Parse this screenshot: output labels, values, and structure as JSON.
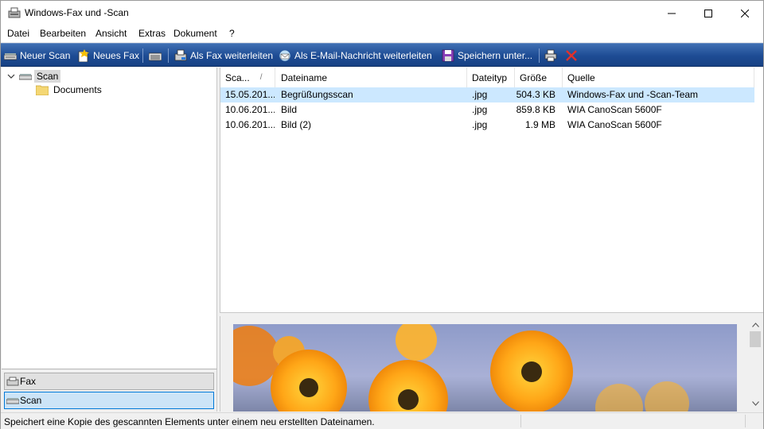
{
  "window": {
    "title": "Windows-Fax und -Scan"
  },
  "menu": [
    {
      "label": "Datei"
    },
    {
      "label": "Bearbeiten"
    },
    {
      "label": "Ansicht"
    },
    {
      "label": "Extras"
    },
    {
      "label": "Dokument"
    },
    {
      "label": "?"
    }
  ],
  "toolbar": {
    "new_scan": "Neuer Scan",
    "new_fax": "Neues Fax",
    "forward_fax": "Als Fax weiterleiten",
    "forward_email": "Als E-Mail-Nachricht weiterleiten",
    "save_as": "Speichern unter...",
    "accent": "#1e4c94"
  },
  "tree": {
    "root": "Scan",
    "children": [
      "Documents"
    ]
  },
  "nav": {
    "fax": "Fax",
    "scan": "Scan"
  },
  "list": {
    "columns": [
      "Sca...",
      "Dateiname",
      "Dateityp",
      "Größe",
      "Quelle"
    ],
    "sort_indicator": "/",
    "rows": [
      {
        "date": "15.05.201...",
        "name": "Begrüßungsscan",
        "type": ".jpg",
        "size": "504.3 KB",
        "source": "Windows-Fax und -Scan-Team",
        "selected": true
      },
      {
        "date": "10.06.201...",
        "name": "Bild",
        "type": ".jpg",
        "size": "859.8 KB",
        "source": "WIA CanoScan 5600F",
        "selected": false
      },
      {
        "date": "10.06.201...",
        "name": "Bild (2)",
        "type": ".jpg",
        "size": "1.9 MB",
        "source": "WIA CanoScan 5600F",
        "selected": false
      }
    ]
  },
  "status": {
    "text": "Speichert eine Kopie des gescannten Elements unter einem neu erstellten Dateinamen."
  }
}
